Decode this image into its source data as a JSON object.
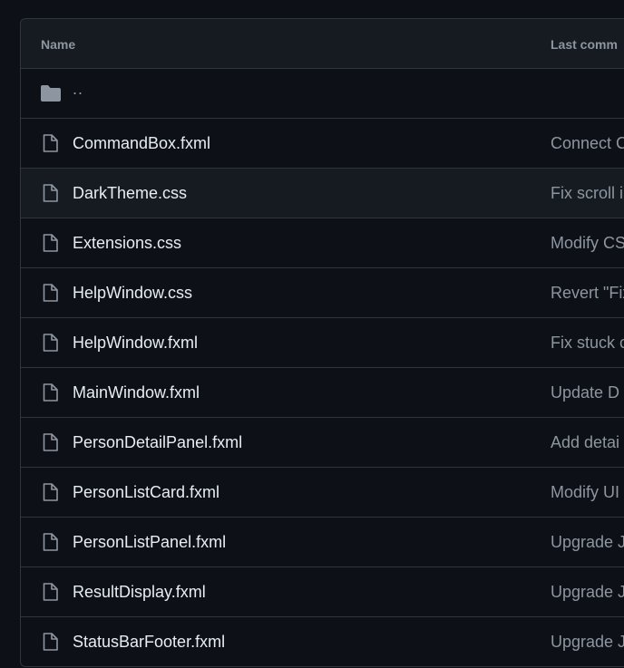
{
  "table": {
    "header": {
      "name_label": "Name",
      "last_commit_label": "Last comm"
    },
    "parent_dir": {
      "label": "..",
      "icon": "folder-icon"
    },
    "files": [
      {
        "name": "CommandBox.fxml",
        "commit": "Connect C",
        "icon": "file-icon"
      },
      {
        "name": "DarkTheme.css",
        "commit": "Fix scroll i",
        "icon": "file-icon",
        "hovered": true
      },
      {
        "name": "Extensions.css",
        "commit": "Modify CS",
        "icon": "file-icon"
      },
      {
        "name": "HelpWindow.css",
        "commit": "Revert \"Fix",
        "icon": "file-icon"
      },
      {
        "name": "HelpWindow.fxml",
        "commit": "Fix stuck c",
        "icon": "file-icon"
      },
      {
        "name": "MainWindow.fxml",
        "commit": "Update D",
        "icon": "file-icon"
      },
      {
        "name": "PersonDetailPanel.fxml",
        "commit": "Add detai",
        "icon": "file-icon"
      },
      {
        "name": "PersonListCard.fxml",
        "commit": "Modify UI",
        "icon": "file-icon"
      },
      {
        "name": "PersonListPanel.fxml",
        "commit": "Upgrade J",
        "icon": "file-icon"
      },
      {
        "name": "ResultDisplay.fxml",
        "commit": "Upgrade J",
        "icon": "file-icon"
      },
      {
        "name": "StatusBarFooter.fxml",
        "commit": "Upgrade J",
        "icon": "file-icon"
      }
    ]
  },
  "colors": {
    "background": "#0d1117",
    "header_background": "#161b22",
    "border": "#30363d",
    "text_primary": "#e6edf3",
    "text_muted": "#8d96a0"
  }
}
